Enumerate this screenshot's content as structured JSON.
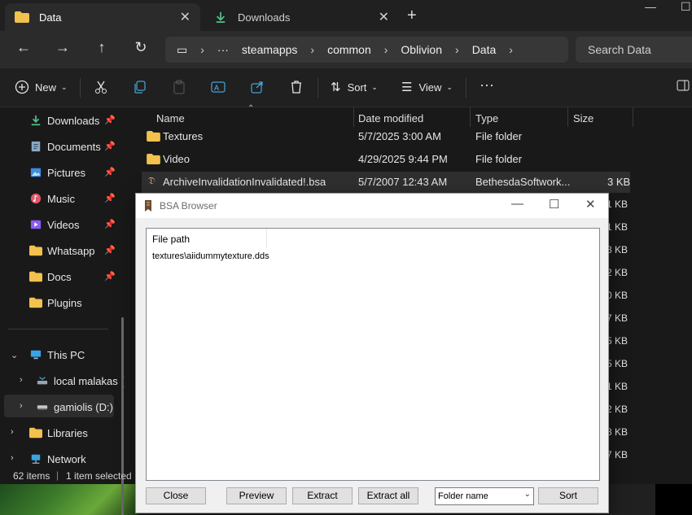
{
  "tabs": [
    {
      "label": "Data",
      "icon": "folder-icon"
    },
    {
      "label": "Downloads",
      "icon": "download-icon"
    }
  ],
  "address": {
    "overflow": "···",
    "crumbs": [
      "steamapps",
      "common",
      "Oblivion",
      "Data"
    ],
    "search_placeholder": "Search Data"
  },
  "toolbar": {
    "new_label": "New",
    "sort_label": "Sort",
    "view_label": "View"
  },
  "sidebar": {
    "quick": [
      {
        "label": "Downloads"
      },
      {
        "label": "Documents"
      },
      {
        "label": "Pictures"
      },
      {
        "label": "Music"
      },
      {
        "label": "Videos"
      },
      {
        "label": "Whatsapp"
      },
      {
        "label": "Docs"
      },
      {
        "label": "Plugins"
      }
    ],
    "this_pc": "This PC",
    "drives": [
      "local malakas (",
      "gamiolis (D:)"
    ],
    "libraries": "Libraries",
    "network": "Network"
  },
  "status": {
    "items": "62 items",
    "selected": "1 item selected"
  },
  "columns": {
    "name": "Name",
    "date": "Date modified",
    "type": "Type",
    "size": "Size"
  },
  "files": [
    {
      "name": "Textures",
      "date": "5/7/2025 3:00 AM",
      "type": "File folder",
      "size": ""
    },
    {
      "name": "Video",
      "date": "4/29/2025 9:44 PM",
      "type": "File folder",
      "size": ""
    },
    {
      "name": "ArchiveInvalidationInvalidated!.bsa",
      "date": "5/7/2007 12:43 AM",
      "type": "BethesdaSoftwork...",
      "size": "3 KB"
    }
  ],
  "hidden_sizes": [
    "1 KB",
    "1 KB",
    "8 KB",
    "2 KB",
    "0 KB",
    "7 KB",
    "5 KB",
    "5 KB",
    "1 KB",
    "2 KB",
    "8 KB",
    "2 KB",
    "7 KB"
  ],
  "dialog": {
    "title": "BSA Browser",
    "column": "File path",
    "entries": [
      "textures\\aiidummytexture.dds"
    ],
    "buttons": {
      "close": "Close",
      "preview": "Preview",
      "extract": "Extract",
      "extract_all": "Extract all",
      "sort": "Sort"
    },
    "sort_select": "Folder name"
  },
  "colors": {
    "folder": "#f2c14e",
    "accent": "#4cc2ff",
    "download": "#4fc185"
  }
}
